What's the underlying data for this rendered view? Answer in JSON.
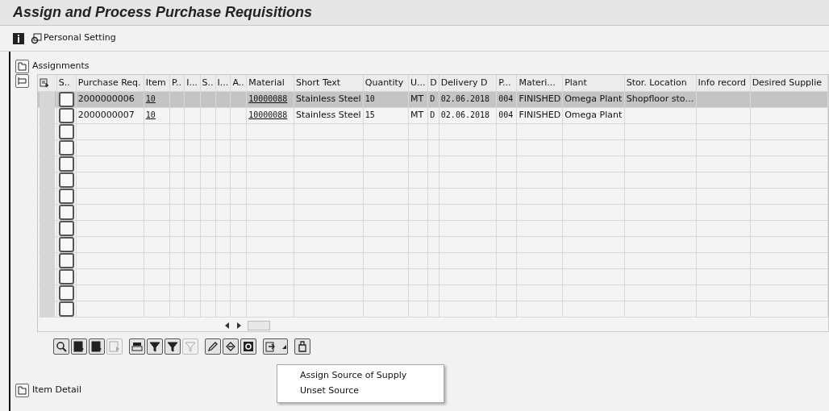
{
  "window": {
    "title": "Assign and Process Purchase Requisitions"
  },
  "toolbar": {
    "personal_setting": "Personal Setting"
  },
  "assignments": {
    "label": "Assignments",
    "table": {
      "columns": [
        {
          "label": "S.."
        },
        {
          "label": "Purchase Req.",
          "kind": "text"
        },
        {
          "label": "Item",
          "kind": "link"
        },
        {
          "label": "P..",
          "kind": "text"
        },
        {
          "label": "I...",
          "kind": "text"
        },
        {
          "label": "S..",
          "kind": "text"
        },
        {
          "label": "I...",
          "kind": "text"
        },
        {
          "label": "A..",
          "kind": "text"
        },
        {
          "label": "Material",
          "kind": "link"
        },
        {
          "label": "Short Text",
          "kind": "text"
        },
        {
          "label": "Quantity",
          "kind": "mono"
        },
        {
          "label": "U...",
          "kind": "text"
        },
        {
          "label": "D",
          "kind": "mono"
        },
        {
          "label": "Delivery D",
          "kind": "mono"
        },
        {
          "label": "P...",
          "kind": "mono"
        },
        {
          "label": "Materi...",
          "kind": "text"
        },
        {
          "label": "Plant",
          "kind": "text"
        },
        {
          "label": "Stor. Location",
          "kind": "text"
        },
        {
          "label": "Info record",
          "kind": "text"
        },
        {
          "label": "Desired Supplie",
          "kind": "text"
        }
      ],
      "rows": [
        {
          "selected": true,
          "cells": [
            "",
            "2000000006",
            "10",
            "",
            "",
            "",
            "",
            "",
            "10000088",
            "Stainless Steel",
            "10",
            "MT",
            "D",
            "02.06.2018",
            "004",
            "FINISHED",
            "Omega Plant",
            "Shopfloor sto…",
            "",
            ""
          ]
        },
        {
          "selected": false,
          "cells": [
            "",
            "2000000007",
            "10",
            "",
            "",
            "",
            "",
            "",
            "10000088",
            "Stainless Steel",
            "15",
            "MT",
            "D",
            "02.06.2018",
            "004",
            "FINISHED",
            "Omega Plant",
            "",
            "",
            ""
          ]
        },
        {
          "selected": false
        },
        {
          "selected": false
        },
        {
          "selected": false
        },
        {
          "selected": false
        },
        {
          "selected": false
        },
        {
          "selected": false
        },
        {
          "selected": false
        },
        {
          "selected": false
        },
        {
          "selected": false
        },
        {
          "selected": false
        },
        {
          "selected": false
        },
        {
          "selected": false
        }
      ]
    },
    "toolbar_groups": [
      [
        {
          "disabled": false
        },
        {
          "disabled": false
        },
        {
          "disabled": false
        },
        {
          "disabled": true
        }
      ],
      [
        {
          "disabled": false
        },
        {
          "disabled": false
        },
        {
          "disabled": false
        },
        {
          "disabled": true
        }
      ],
      [
        {
          "disabled": false
        },
        {
          "disabled": false
        },
        {
          "disabled": false
        }
      ],
      [
        {
          "disabled": false
        }
      ],
      [
        {
          "disabled": false
        }
      ]
    ],
    "menu": {
      "items": [
        "Assign Source of Supply",
        "Unset Source"
      ]
    }
  },
  "item_detail": {
    "label": "Item Detail"
  }
}
